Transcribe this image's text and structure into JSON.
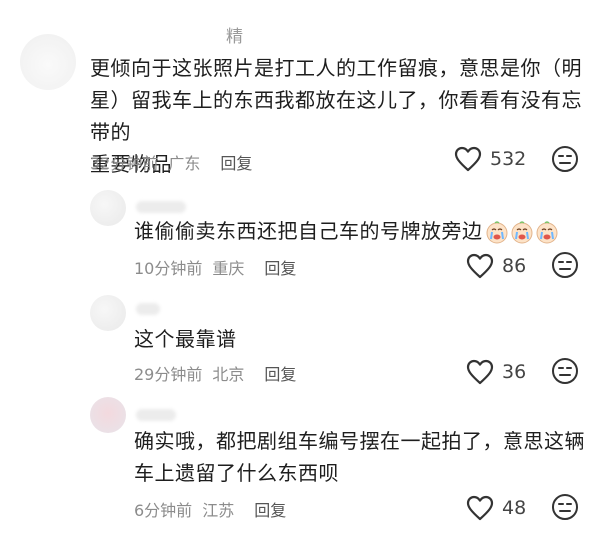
{
  "comments": [
    {
      "author": "精",
      "text_lines": [
        "更倾向于这张照片是打工人的工作留痕，意思是你（明",
        "星）留我车上的东西我都放在这儿了，你看看有没有忘带的",
        "重要物品"
      ],
      "time": "32分钟前",
      "location": "广东",
      "reply_label": "回复",
      "likes": "532"
    },
    {
      "author": "",
      "text_lines": [
        "谁偷偷卖东西还把自己车的号牌放旁边"
      ],
      "emojis": [
        "crying-face-emoji",
        "crying-face-emoji",
        "crying-face-emoji"
      ],
      "time": "10分钟前",
      "location": "重庆",
      "reply_label": "回复",
      "likes": "86"
    },
    {
      "author": "",
      "text_lines": [
        "这个最靠谱"
      ],
      "time": "29分钟前",
      "location": "北京",
      "reply_label": "回复",
      "likes": "36"
    },
    {
      "author": "",
      "text_lines": [
        "确实哦，都把剧组车编号摆在一起拍了，意思这辆",
        "车上遗留了什么东西呗"
      ],
      "time": "6分钟前",
      "location": "江苏",
      "reply_label": "回复",
      "likes": "48"
    }
  ],
  "icons": {
    "like": "heart-outline-icon",
    "dislike": "unhappy-face-icon"
  },
  "colors": {
    "text": "#1e1e1e",
    "meta": "#8c8c8c",
    "icon": "#333333"
  }
}
